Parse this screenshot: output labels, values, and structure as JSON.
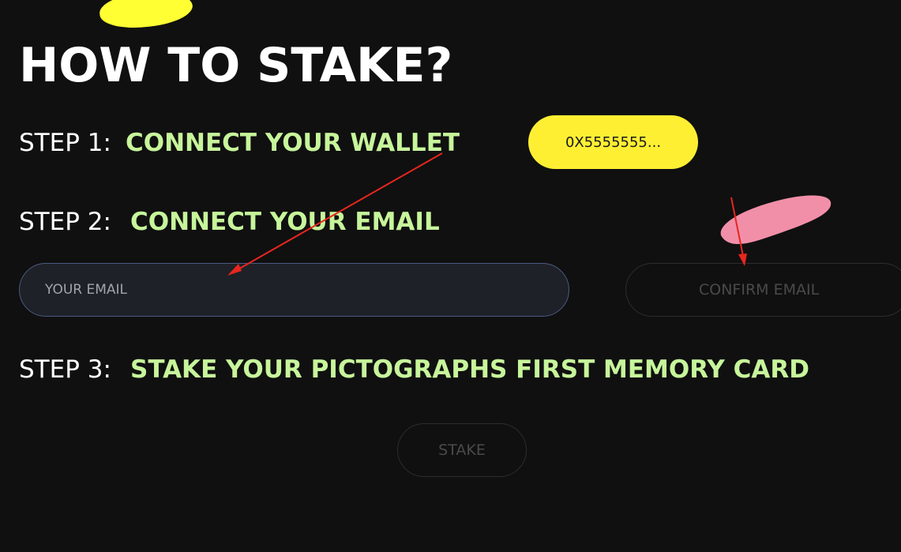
{
  "header": {
    "title": "HOW TO STAKE?"
  },
  "steps": {
    "step1": {
      "label": "STEP 1:",
      "text": "CONNECT YOUR WALLET"
    },
    "step2": {
      "label": "STEP 2:",
      "text": "CONNECT YOUR EMAIL"
    },
    "step3": {
      "label": "STEP 3:",
      "text": "STAKE YOUR PICTOGRAPHS FIRST MEMORY CARD"
    }
  },
  "wallet": {
    "address_label": "0X5555555..."
  },
  "email": {
    "placeholder": "YOUR EMAIL",
    "value": "",
    "confirm_label": "CONFIRM EMAIL"
  },
  "stake": {
    "button_label": "STAKE"
  },
  "colors": {
    "background": "#101010",
    "accent_green": "#c7f59b",
    "accent_yellow": "#ffef33",
    "accent_pink": "#f28fa8",
    "annotation_red": "#e8261e"
  }
}
